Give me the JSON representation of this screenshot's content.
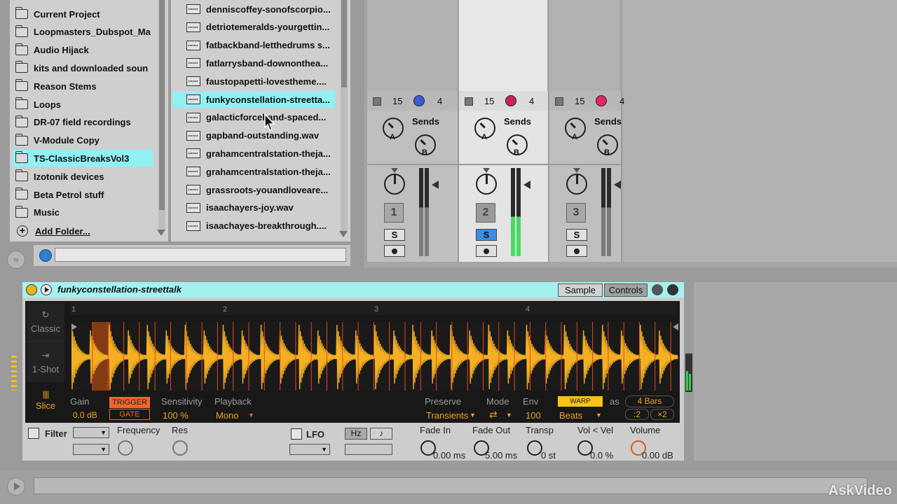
{
  "places": {
    "items": [
      {
        "label": "Current Project",
        "selected": false
      },
      {
        "label": "Loopmasters_Dubspot_Ma",
        "selected": false
      },
      {
        "label": "Audio Hijack",
        "selected": false
      },
      {
        "label": "kits and downloaded soun",
        "selected": false
      },
      {
        "label": "Reason Stems",
        "selected": false
      },
      {
        "label": "Loops",
        "selected": false
      },
      {
        "label": "DR-07 field recordings",
        "selected": false
      },
      {
        "label": "V-Module Copy",
        "selected": false
      },
      {
        "label": "TS-ClassicBreaksVol3",
        "selected": true
      },
      {
        "label": "Izotonik devices",
        "selected": false
      },
      {
        "label": "Beta Petrol stuff",
        "selected": false
      },
      {
        "label": "Music",
        "selected": false
      }
    ],
    "add_folder": "Add Folder..."
  },
  "files": {
    "items": [
      {
        "label": "denniscoffey-sonofscorpio...",
        "selected": false
      },
      {
        "label": "detriotemeralds-yourgettin...",
        "selected": false
      },
      {
        "label": "fatbackband-letthedrums s...",
        "selected": false
      },
      {
        "label": "fatlarrysband-downonthea...",
        "selected": false
      },
      {
        "label": "faustopapetti-lovestheme....",
        "selected": false
      },
      {
        "label": "funkyconstellation-streetta...",
        "selected": true
      },
      {
        "label": "galacticforceband-spaced...",
        "selected": false
      },
      {
        "label": "gapband-outstanding.wav",
        "selected": false
      },
      {
        "label": "grahamcentralstation-theja...",
        "selected": false
      },
      {
        "label": "grahamcentralstation-theja...",
        "selected": false
      },
      {
        "label": "grassroots-youandloveare...",
        "selected": false
      },
      {
        "label": "isaachayers-joy.wav",
        "selected": false
      },
      {
        "label": "isaachayes-breakthrough....",
        "selected": false
      }
    ]
  },
  "mixer": {
    "channels": [
      {
        "in": "15",
        "out": "4",
        "sends": "Sends",
        "send_a": "A",
        "send_b": "B",
        "track": "1",
        "solo": "S",
        "selected": false,
        "color": "#3a5bd9"
      },
      {
        "in": "15",
        "out": "4",
        "sends": "Sends",
        "send_a": "A",
        "send_b": "B",
        "track": "2",
        "solo": "S",
        "selected": true,
        "color": "#c8245a"
      },
      {
        "in": "15",
        "out": "4",
        "sends": "Sends",
        "send_a": "A",
        "send_b": "B",
        "track": "3",
        "solo": "S",
        "selected": false,
        "color": "#e0266a"
      }
    ]
  },
  "device": {
    "title": "funkyconstellation-streettalk",
    "tab_sample": "Sample",
    "tab_controls": "Controls",
    "modes": {
      "classic": "Classic",
      "one_shot": "1-Shot",
      "slice": "Slice"
    },
    "bar_markers": [
      "1",
      "2",
      "3",
      "4"
    ],
    "gain_label": "Gain",
    "gain_value": "0.0 dB",
    "trigger": "TRIGGER",
    "gate": "GATE",
    "sensitivity_label": "Sensitivity",
    "sensitivity_value": "100 %",
    "playback_label": "Playback",
    "playback_value": "Mono",
    "preserve_label": "Preserve",
    "preserve_value": "Transients",
    "mode_label": "Mode",
    "env_label": "Env",
    "env_value": "100",
    "warp": "WARP",
    "as_label": "as",
    "bars_value": "4 Bars",
    "beats_value": "Beats",
    "half": ":2",
    "double": "×2",
    "filter_label": "Filter",
    "frequency_label": "Frequency",
    "res_label": "Res",
    "lfo_label": "LFO",
    "hz_label": "Hz",
    "note_label": "♪",
    "fade_in_label": "Fade In",
    "fade_in_value": "0.00 ms",
    "fade_out_label": "Fade Out",
    "fade_out_value": "5.00 ms",
    "transp_label": "Transp",
    "transp_value": "0 st",
    "vol_vel_label": "Vol < Vel",
    "vol_vel_value": "0.0 %",
    "volume_label": "Volume",
    "volume_value": "0.00 dB"
  },
  "watermark": "AskVideo"
}
